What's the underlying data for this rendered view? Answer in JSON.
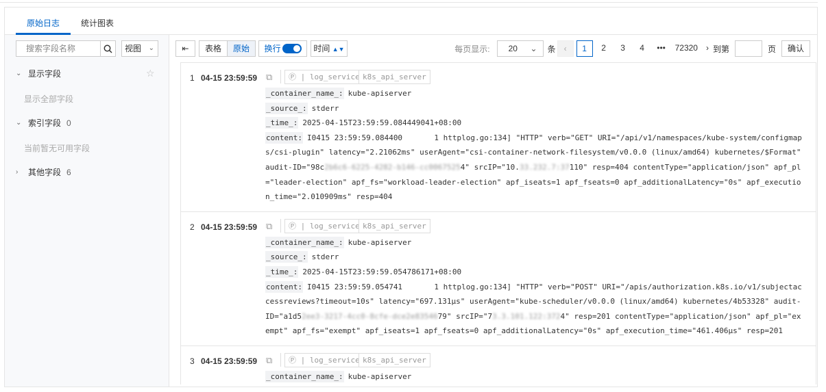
{
  "tabs": [
    "原始日志",
    "统计图表"
  ],
  "sidebar": {
    "search_placeholder": "搜索字段名称",
    "view_label": "视图",
    "sections": [
      {
        "label": "显示字段",
        "count": "",
        "sub": "显示全部字段"
      },
      {
        "label": "索引字段",
        "count": "0",
        "sub": "当前暂无可用字段"
      },
      {
        "label": "其他字段",
        "count": "6"
      }
    ]
  },
  "toolbar": {
    "table": "表格",
    "raw": "原始",
    "wrap": "换行",
    "time": "时间",
    "wrap_on": true
  },
  "pager": {
    "per_page_label": "每页显示:",
    "per_page": "20",
    "unit": "条",
    "pages": [
      "1",
      "2",
      "3",
      "4",
      "•••",
      "72320"
    ],
    "current": "1",
    "goto_label": "到第",
    "page_unit": "页",
    "confirm": "确认"
  },
  "logs": [
    {
      "num": "1",
      "time": "04-15 23:59:59",
      "tags": [
        "log_service",
        "k8s_api_server"
      ],
      "fields": [
        {
          "k": "_container_name_:",
          "v": "kube-apiserver"
        },
        {
          "k": "_source_:",
          "v": "stderr"
        },
        {
          "k": "_time_:",
          "v": "2025-04-15T23:59:59.084449041+08:00"
        }
      ],
      "content_key": "content:",
      "content": [
        "I0415 23:59:59.084400       1 httplog.go:134] \"HTTP\" verb=\"GET\" URI=\"/api/v1/namespaces/kube-system/configmaps/csi-plugin\" latency=\"2.21062ms\" userAgent=\"csi-container-network-filesystem/v0.0.0 (linux/amd64) kubernetes/$Format\" audit-ID=\"98c",
        "2b6c6-6225-4282-b146-cc0067525",
        "4\" srcIP=\"10.",
        "33.232.7:37",
        "110\" resp=404 contentType=\"application/json\" apf_pl=\"leader-election\" apf_fs=\"workload-leader-election\" apf_iseats=1 apf_fseats=0 apf_additionalLatency=\"0s\" apf_execution_time=\"2.010909ms\" resp=404"
      ]
    },
    {
      "num": "2",
      "time": "04-15 23:59:59",
      "tags": [
        "log_service",
        "k8s_api_server"
      ],
      "fields": [
        {
          "k": "_container_name_:",
          "v": "kube-apiserver"
        },
        {
          "k": "_source_:",
          "v": "stderr"
        },
        {
          "k": "_time_:",
          "v": "2025-04-15T23:59:59.054786171+08:00"
        }
      ],
      "content_key": "content:",
      "content": [
        "I0415 23:59:59.054741       1 httplog.go:134] \"HTTP\" verb=\"POST\" URI=\"/apis/authorization.k8s.io/v1/subjectaccessreviews?timeout=10s\" latency=\"697.131µs\" userAgent=\"kube-scheduler/v0.0.0 (linux/amd64) kubernetes/4b53328\" audit-ID=\"a1d5",
        "2ee3-3217-4cc0-8cfe-dce2e83546",
        "79\" srcIP=\"7",
        "3.3.101.122:372",
        "4\" resp=201 contentType=\"application/json\" apf_pl=\"exempt\" apf_fs=\"exempt\" apf_iseats=1 apf_fseats=0 apf_additionalLatency=\"0s\" apf_execution_time=\"461.406µs\" resp=201"
      ]
    },
    {
      "num": "3",
      "time": "04-15 23:59:59",
      "tags": [
        "log_service",
        "k8s_api_server"
      ],
      "fields": [
        {
          "k": "_container_name_:",
          "v": "kube-apiserver"
        }
      ]
    }
  ]
}
